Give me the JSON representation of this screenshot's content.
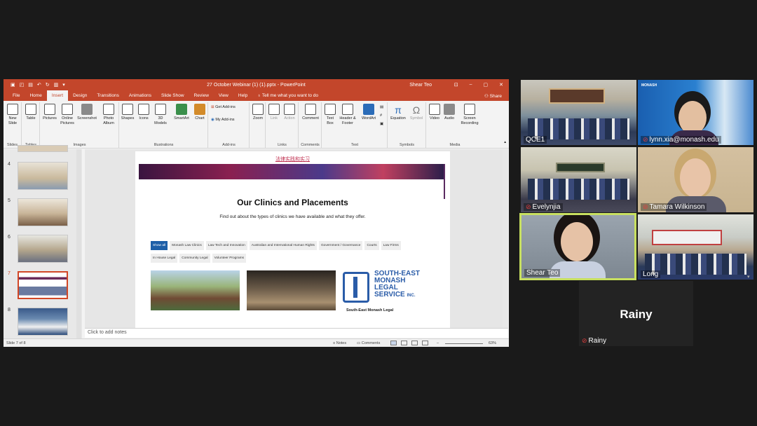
{
  "ppt": {
    "window_title": "27 October Webinar (1) (1).pptx  -  PowerPoint",
    "user": "Shear Teo",
    "tabs": [
      "File",
      "Home",
      "Insert",
      "Design",
      "Transitions",
      "Animations",
      "Slide Show",
      "Review",
      "View",
      "Help"
    ],
    "active_tab": "Insert",
    "tell_me": "Tell me what you want to do",
    "share": "Share",
    "ribbon": {
      "new_slide": "New Slide",
      "table": "Table",
      "pictures": "Pictures",
      "online_pictures": "Online Pictures",
      "screenshot": "Screenshot",
      "photo_album": "Photo Album",
      "shapes": "Shapes",
      "icons": "Icons",
      "models_3d": "3D Models",
      "smartart": "SmartArt",
      "chart": "Chart",
      "get_addins": "Get Add-ins",
      "my_addins": "My Add-ins",
      "zoom": "Zoom",
      "link": "Link",
      "action": "Action",
      "comment": "Comment",
      "text_box": "Text Box",
      "header_footer": "Header & Footer",
      "wordart": "WordArt",
      "equation": "Equation",
      "symbol": "Symbol",
      "video": "Video",
      "audio": "Audio",
      "screen_recording": "Screen Recording",
      "groups": {
        "slides": "Slides",
        "tables": "Tables",
        "images": "Images",
        "illustrations": "Illustrations",
        "addins": "Add-ins",
        "links": "Links",
        "comments": "Comments",
        "text": "Text",
        "symbols": "Symbols",
        "media": "Media"
      }
    },
    "thumbnails": [
      "4",
      "5",
      "6",
      "7",
      "8"
    ],
    "selected_slide": "7",
    "slide": {
      "top_link": "法律实践和实习",
      "heading": "Our Clinics and Placements",
      "subheading": "Find out about the types of clinics we have available and what they offer.",
      "filters_row1": [
        "Show all",
        "Monash Law Clinics",
        "Law Tech and Innovation",
        "Australian and International Human Rights",
        "Government / Governance",
        "Courts",
        "Law Firms"
      ],
      "filters_row2": [
        "In House Legal",
        "Community Legal",
        "Volunteer Programs"
      ],
      "logo_lines": [
        "SOUTH-EAST",
        "MONASH",
        "LEGAL",
        "SERVICE"
      ],
      "logo_inc": "INC.",
      "logo_caption": "South-East Monash Legal"
    },
    "notes_placeholder": "Click to add notes",
    "status": {
      "slide_info": "Slide 7 of 8",
      "notes": "Notes",
      "comments": "Comments",
      "zoom_pct": "63%"
    }
  },
  "zoom": {
    "participants": [
      {
        "name": "QCE1",
        "muted": false
      },
      {
        "name": "lynn.xia@monash.edu",
        "muted": true
      },
      {
        "name": "Evelynjia",
        "muted": true
      },
      {
        "name": "Tamara Wilkinson",
        "muted": true
      },
      {
        "name": "Shear Teo",
        "muted": false
      },
      {
        "name": "Long",
        "muted": false
      },
      {
        "name": "Rainy",
        "muted": true
      }
    ],
    "rainy_big": "Rainy",
    "lynn_logo": "MONASH"
  }
}
